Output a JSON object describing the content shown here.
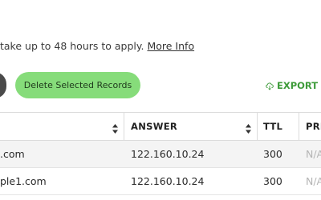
{
  "notice": {
    "text": "take up to 48 hours to apply.",
    "link": "More Info"
  },
  "toolbar": {
    "delete_label": "Delete Selected Records",
    "export_label": "EXPORT DN"
  },
  "table": {
    "headers": {
      "answer": "ANSWER",
      "ttl": "TTL",
      "priority": "PRI"
    },
    "rows": [
      {
        "host": ".com",
        "answer": "122.160.10.24",
        "ttl": "300",
        "priority": "N/A"
      },
      {
        "host": "ple1.com",
        "answer": "122.160.10.24",
        "ttl": "300",
        "priority": "N/A"
      }
    ]
  }
}
